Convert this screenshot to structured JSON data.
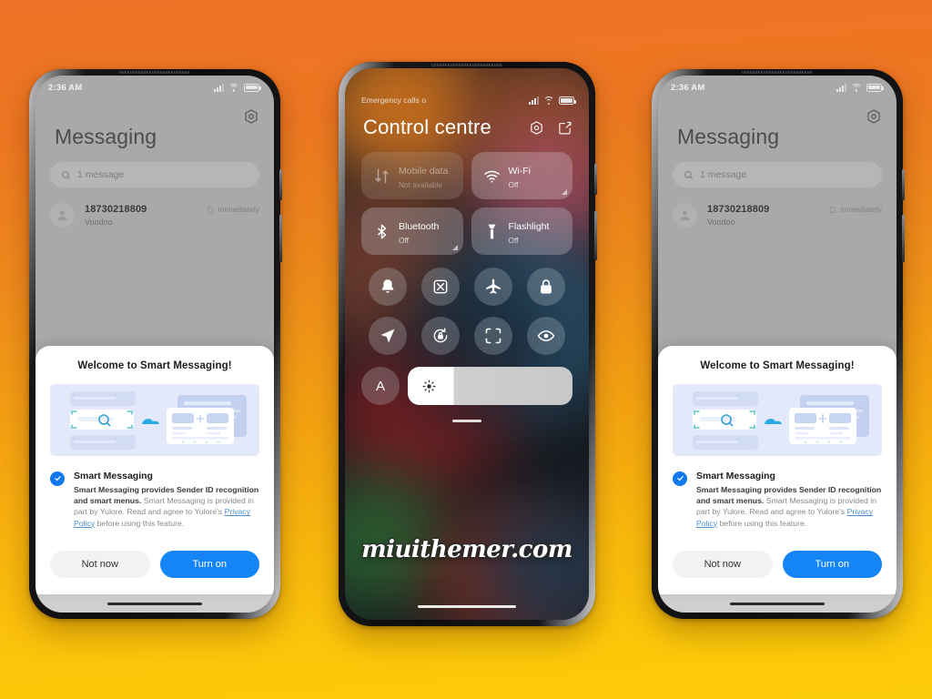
{
  "background": {
    "top_color": "#ED7326",
    "bottom_color": "#FCC80A"
  },
  "phones": {
    "left": {
      "status_bar": {
        "time": "2:36 AM",
        "icons": [
          "signal-icon",
          "wifi-icon",
          "battery-icon"
        ]
      },
      "app": {
        "gear_icon": "gear-icon",
        "title": "Messaging",
        "search": {
          "icon": "search-icon",
          "value": "1 message"
        },
        "conversation": {
          "avatar_icon": "person-icon",
          "name": "18730218809",
          "preview": "Voodoo",
          "status_icon": "sim-icon",
          "time": "Immediately"
        }
      },
      "dialog": {
        "title": "Welcome to Smart Messaging!",
        "illustration": "smart-messaging-illustration",
        "check_icon": "checkmark-icon",
        "feature_name": "Smart Messaging",
        "body_bold": "Smart Messaging provides Sender ID recognition and smart menus.",
        "body_rest_1": " Smart Messaging is provided in part by Yulore. Read and agree to Yulore's ",
        "body_link": "Privacy Policy",
        "body_rest_2": " before using this feature.",
        "secondary_button": "Not now",
        "primary_button": "Turn on",
        "primary_color": "#1585F5"
      }
    },
    "center": {
      "status_bar": {
        "carrier": "Emergency calls o",
        "icons": [
          "signal-icon",
          "wifi-icon",
          "battery-icon"
        ]
      },
      "title": "Control centre",
      "header_icons": [
        {
          "name": "settings-hex-icon"
        },
        {
          "name": "edit-icon"
        }
      ],
      "tiles": [
        {
          "icon": "mobile-data-icon",
          "label": "Mobile data",
          "sub": "Not available",
          "disabled": true,
          "expandable": false
        },
        {
          "icon": "wifi-icon",
          "label": "Wi-Fi",
          "sub": "Off",
          "disabled": false,
          "expandable": true
        },
        {
          "icon": "bluetooth-icon",
          "label": "Bluetooth",
          "sub": "Off",
          "disabled": false,
          "expandable": true
        },
        {
          "icon": "flashlight-icon",
          "label": "Flashlight",
          "sub": "Off",
          "disabled": false,
          "expandable": false
        }
      ],
      "toggles": [
        {
          "icon": "bell-icon"
        },
        {
          "icon": "screenshot-icon"
        },
        {
          "icon": "airplane-icon"
        },
        {
          "icon": "lock-icon"
        },
        {
          "icon": "location-arrow-icon"
        },
        {
          "icon": "rotation-lock-icon"
        },
        {
          "icon": "scan-icon"
        },
        {
          "icon": "eye-icon"
        }
      ],
      "auto_brightness": {
        "icon": "auto-brightness-a-icon",
        "label": "A"
      },
      "brightness_slider": {
        "icon": "sun-icon",
        "value_percent": 28
      },
      "watermark": "miuithemer.com"
    },
    "right": {
      "status_bar": {
        "time": "2:36 AM",
        "icons": [
          "signal-icon",
          "wifi-icon",
          "battery-icon"
        ]
      },
      "app": {
        "gear_icon": "gear-icon",
        "title": "Messaging",
        "search": {
          "icon": "search-icon",
          "value": "1 message"
        },
        "conversation": {
          "avatar_icon": "person-icon",
          "name": "18730218809",
          "preview": "Voodoo",
          "status_icon": "sim-icon",
          "time": "Immediately"
        }
      },
      "dialog": {
        "title": "Welcome to Smart Messaging!",
        "illustration": "smart-messaging-illustration",
        "check_icon": "checkmark-icon",
        "feature_name": "Smart Messaging",
        "body_bold": "Smart Messaging provides Sender ID recognition and smart menus.",
        "body_rest_1": " Smart Messaging is provided in part by Yulore. Read and agree to Yulore's ",
        "body_link": "Privacy Policy",
        "body_rest_2": " before using this feature.",
        "secondary_button": "Not now",
        "primary_button": "Turn on",
        "primary_color": "#1585F5"
      }
    }
  }
}
